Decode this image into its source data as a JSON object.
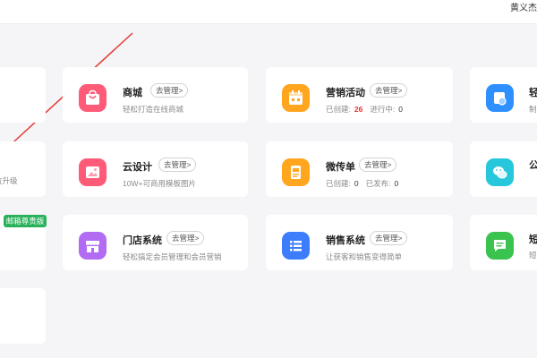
{
  "header": {
    "user_name": "黄义杰"
  },
  "left_column": {
    "partial_desc": "位升级",
    "badge": "邮箱尊贵版"
  },
  "apps": [
    {
      "title": "商城",
      "manage": "去管理>",
      "desc": "轻松打造在线商城",
      "color": "#fe5b78"
    },
    {
      "title": "营销活动",
      "manage": "去管理>",
      "created_label": "已创建:",
      "created_value": "26",
      "progress_label": "进行中:",
      "progress_value": "0",
      "color": "#ffa51e"
    },
    {
      "title": "云设计",
      "manage": "去管理>",
      "desc": "10W+可商用模板图片",
      "color": "#fe5b78"
    },
    {
      "title": "微传单",
      "manage": "去管理>",
      "created_label": "已创建:",
      "created_value": "0",
      "published_label": "已发布:",
      "published_value": "0",
      "color": "#ffa51e"
    },
    {
      "title": "门店系统",
      "manage": "去管理>",
      "desc": "轻松搞定会员管理和会员营销",
      "color": "#b16cf3"
    },
    {
      "title": "销售系统",
      "manage": "去管理>",
      "desc": "让获客和销售变得简单",
      "color": "#3d7dfb"
    }
  ],
  "right_column": [
    {
      "title": "轻",
      "desc": "制",
      "color": "#2e90ff"
    },
    {
      "title": "公",
      "desc": "",
      "color": "#26c7da"
    },
    {
      "title": "短",
      "desc": "短",
      "color": "#3bc34f"
    }
  ]
}
